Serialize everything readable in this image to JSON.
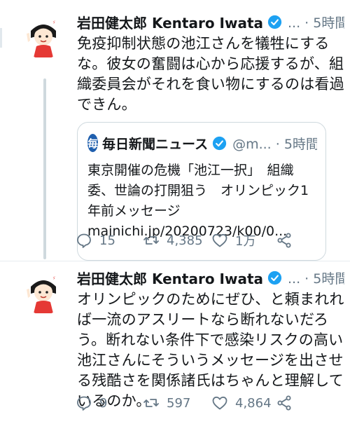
{
  "tweets": [
    {
      "author_name": "岩田健太郎 Kentaro Iwata",
      "meta": "... · 5時間",
      "body": "免疫抑制状態の池江さんを犠牲にするな。彼女の奮闘は心から応援するが、組織委員会がそれを食い物にするのは看過できん。",
      "quote": {
        "logo_char": "毎",
        "name": "毎日新聞ニュース",
        "meta": "@m... · 5時間",
        "text": "東京開催の危機「池江一択」　組織委、世論の打開狙う　オリンピック1年前メッセージ",
        "link": "mainichi.jp/20200723/k00/0..."
      },
      "replies": "15",
      "retweets": "4,385",
      "likes": "1万"
    },
    {
      "author_name": "岩田健太郎 Kentaro Iwata",
      "meta": "... · 5時間",
      "body": "オリンピックのためにぜひ、と頼まれれば一流のアスリートなら断れないだろう。断れない条件下で感染リスクの高い池江さんにそういうメッセージを出させる残酷さを関係諸氏はちゃんと理解しているのか。",
      "replies": "9",
      "retweets": "597",
      "likes": "4,864"
    }
  ],
  "colors": {
    "verified": "#1da1f2",
    "meta_text": "#657786",
    "thread_line": "#cfd9de"
  },
  "icons": [
    "reply-icon",
    "retweet-icon",
    "like-icon",
    "share-icon",
    "verified-icon",
    "avatar-illustration"
  ]
}
